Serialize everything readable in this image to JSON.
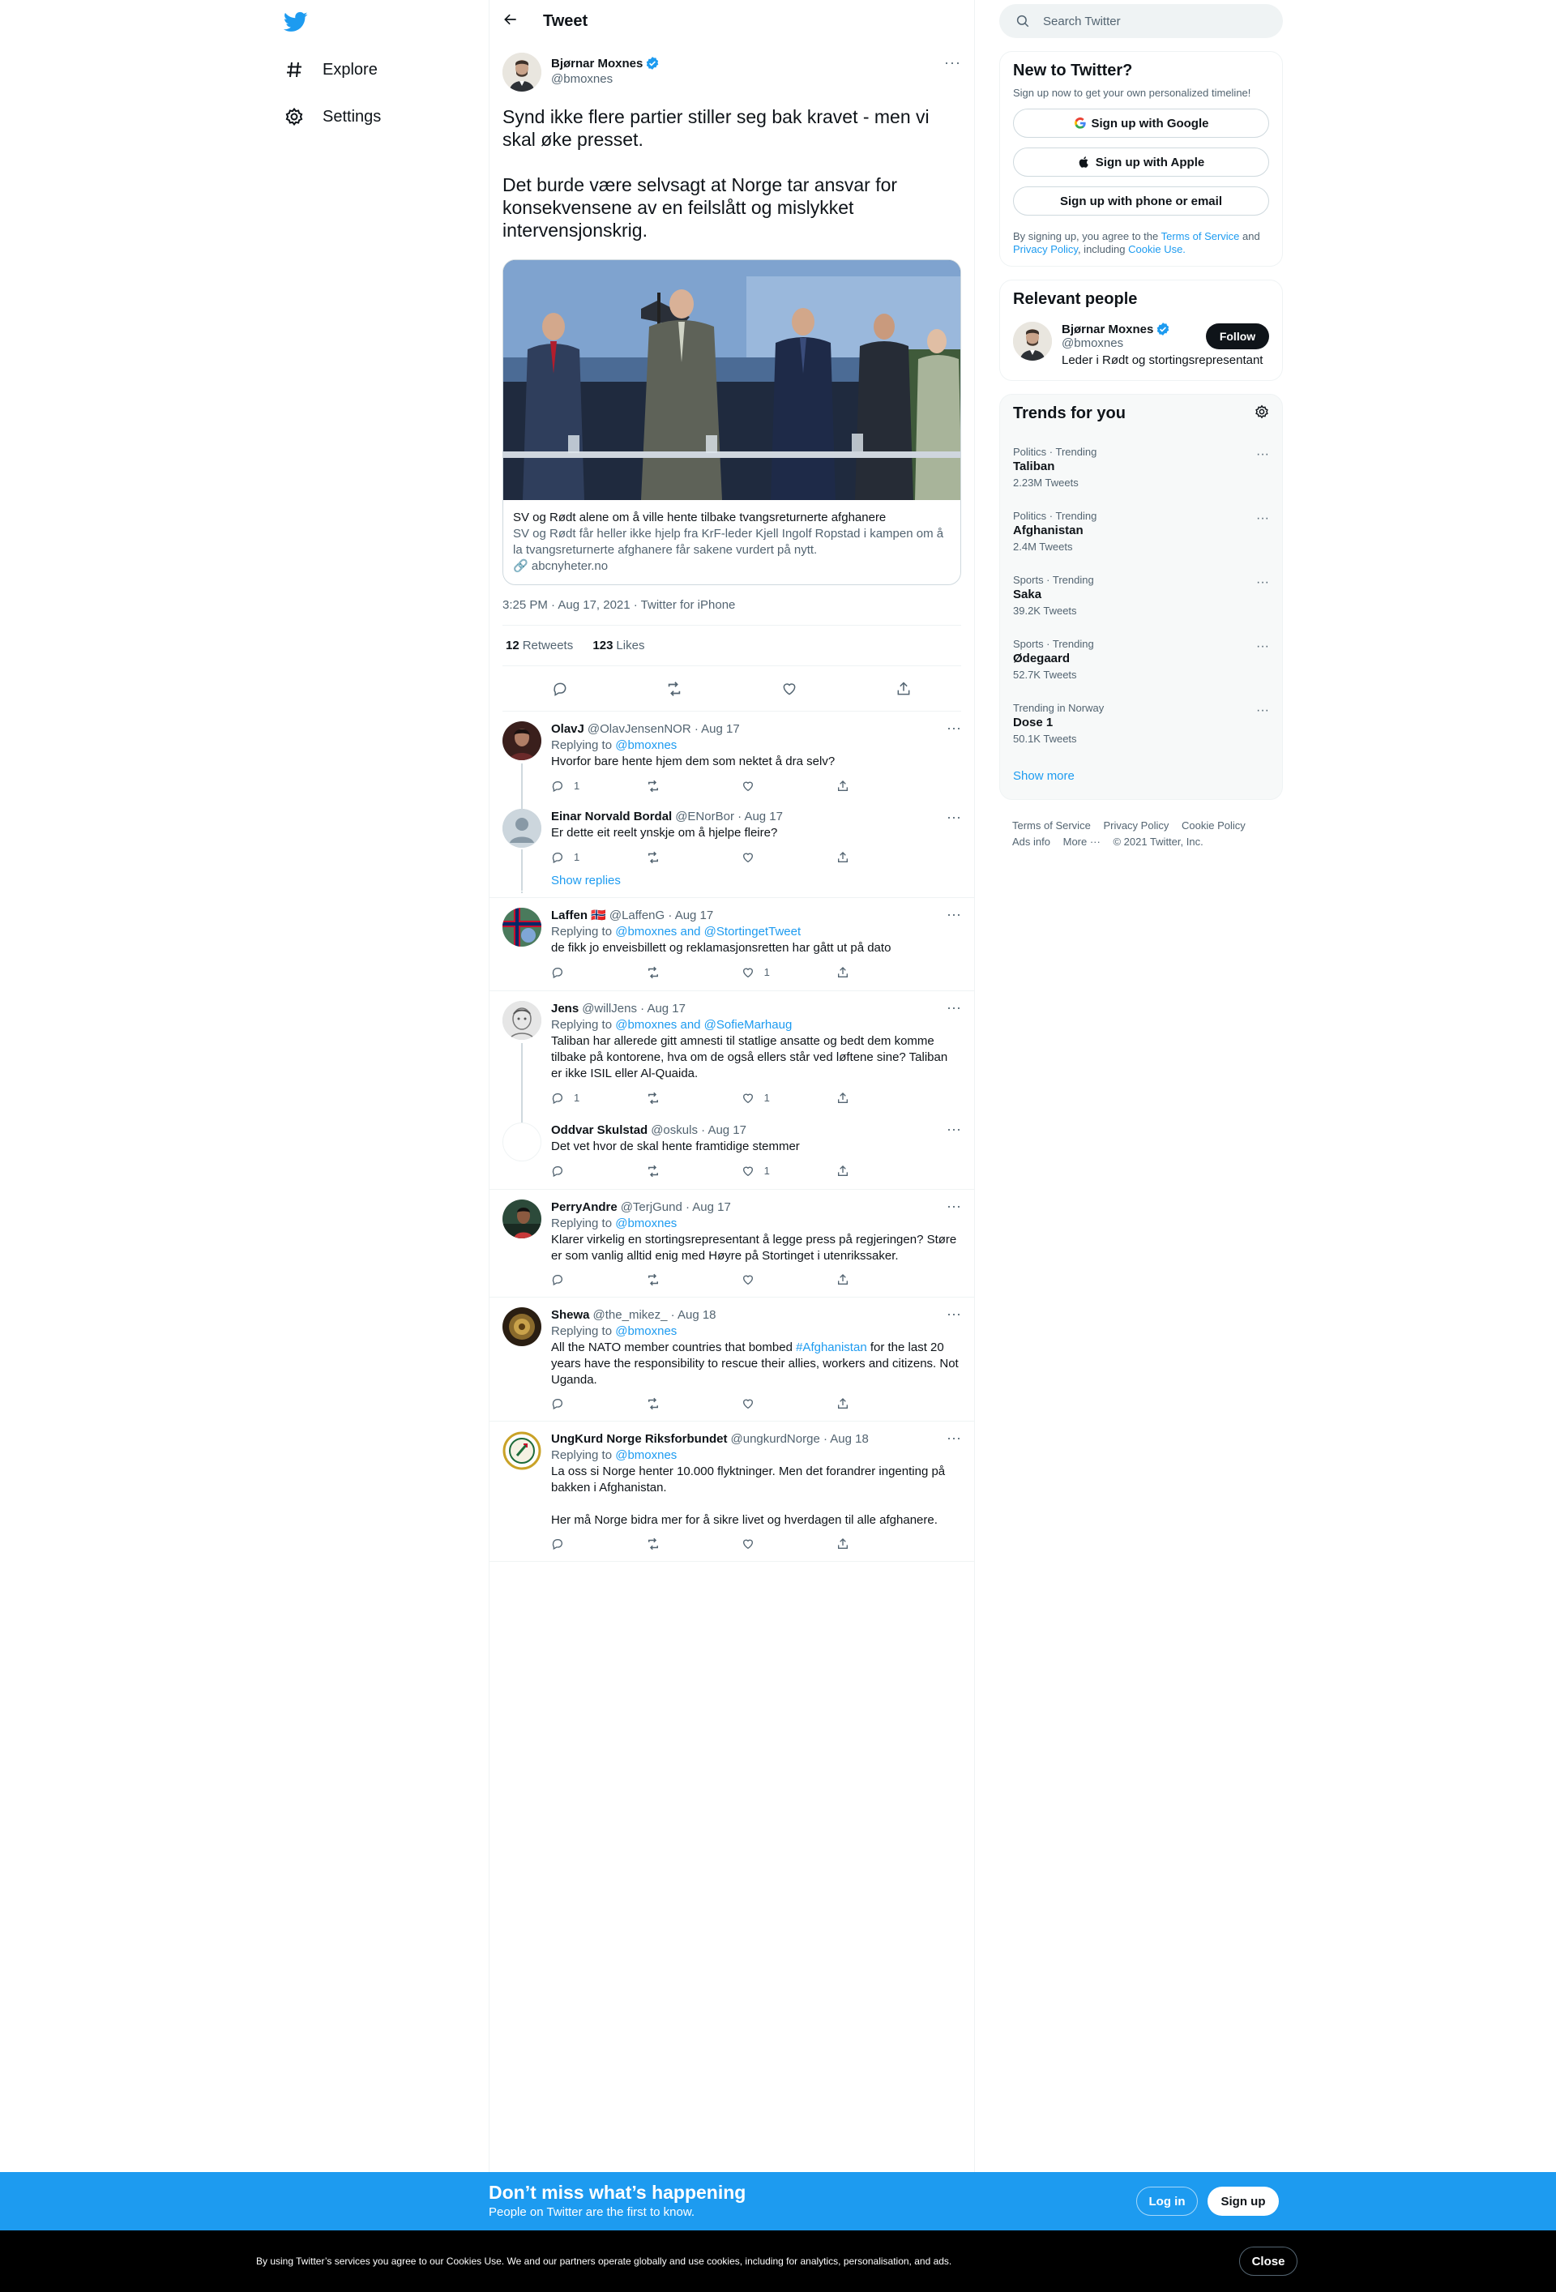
{
  "nav": {
    "explore": "Explore",
    "settings": "Settings"
  },
  "main": {
    "title": "Tweet",
    "tweet": {
      "name": "Bjørnar Moxnes",
      "handle": "@bmoxnes",
      "text": "Synd ikke flere partier stiller seg bak kravet - men vi skal øke presset.\n\nDet burde være selvsagt at Norge tar ansvar for konsekvensene av en feilslått og mislykket intervensjonskrig.",
      "card": {
        "title": "SV og Rødt alene om å ville hente tilbake tvangsreturnerte afghanere",
        "description": "SV og Rødt får heller ikke hjelp fra KrF-leder Kjell Ingolf Ropstad i kampen om å la tvangsreturnerte afghanere får sakene vurdert på nytt.",
        "domain": "abcnyheter.no"
      },
      "timestamp": "3:25 PM · Aug 17, 2021 · Twitter for iPhone",
      "retweets_count": "12",
      "retweets_label": "Retweets",
      "likes_count": "123",
      "likes_label": "Likes"
    },
    "show_replies": "Show replies",
    "replies": [
      {
        "name": "OlavJ",
        "meta": "@OlavJensenNOR · Aug 17",
        "to_prefix": "Replying to ",
        "to": "@bmoxnes",
        "text": "Hvorfor bare hente hjem dem som nektet å dra selv?",
        "replies": "1",
        "retweets": "",
        "likes": ""
      },
      {
        "name": "Einar Norvald Bordal",
        "meta": "@ENorBor · Aug 17",
        "to_prefix": "",
        "to": "",
        "text": "Er dette eit reelt ynskje om å hjelpe fleire?",
        "replies": "1",
        "retweets": "",
        "likes": ""
      },
      {
        "name": "Laffen 🇳🇴",
        "meta": "@LaffenG · Aug 17",
        "to_prefix": "Replying to ",
        "to": "@bmoxnes and @StortingetTweet",
        "text": "de fikk jo enveisbillett og reklamasjonsretten har gått ut på dato",
        "replies": "",
        "retweets": "",
        "likes": "1"
      },
      {
        "name": "Jens",
        "meta": "@willJens · Aug 17",
        "to_prefix": "Replying to ",
        "to": "@bmoxnes and @SofieMarhaug",
        "text": "Taliban har allerede gitt amnesti til statlige ansatte og bedt dem komme tilbake på kontorene, hva om de også ellers står ved løftene sine?  Taliban er ikke ISIL eller Al-Quaida.",
        "replies": "1",
        "retweets": "",
        "likes": "1"
      },
      {
        "name": "Oddvar Skulstad",
        "meta": "@oskuls · Aug 17",
        "to_prefix": "",
        "to": "",
        "text": "Det vet hvor de skal hente framtidige stemmer",
        "replies": "",
        "retweets": "",
        "likes": "1"
      },
      {
        "name": "PerryAndre",
        "meta": "@TerjGund · Aug 17",
        "to_prefix": "Replying to ",
        "to": "@bmoxnes",
        "text": "Klarer virkelig en stortingsrepresentant å legge press på regjeringen? Støre er som vanlig alltid enig med Høyre på Stortinget i utenrikssaker.",
        "replies": "",
        "retweets": "",
        "likes": ""
      },
      {
        "name": "Shewa",
        "meta": "@the_mikez_ · Aug 18",
        "to_prefix": "Replying to ",
        "to": "@bmoxnes",
        "text_before": "All the NATO member countries that bombed ",
        "hashtag": "#Afghanistan",
        "text_after": " for the last 20 years have the responsibility to rescue their allies, workers and citizens. Not Uganda.",
        "replies": "",
        "retweets": "",
        "likes": ""
      },
      {
        "name": "UngKurd Norge Riksforbundet",
        "meta": "@ungkurdNorge · Aug 18",
        "to_prefix": "Replying to ",
        "to": "@bmoxnes",
        "text": "La oss si Norge henter 10.000 flyktninger. Men det forandrer ingenting på bakken i Afghanistan.\n\nHer må Norge bidra mer for å sikre livet og hverdagen til alle afghanere.",
        "replies": "",
        "retweets": "",
        "likes": ""
      }
    ]
  },
  "sidebar": {
    "search_placeholder": "Search Twitter",
    "new": {
      "title": "New to Twitter?",
      "subtitle": "Sign up now to get your own personalized timeline!",
      "google": "Sign up with Google",
      "apple": "Sign up with Apple",
      "phone": "Sign up with phone or email",
      "terms_prefix": "By signing up, you agree to the ",
      "terms_link": "Terms of Service",
      "terms_and": " and ",
      "privacy_link": "Privacy Policy",
      "terms_including": ", including ",
      "cookie_link": "Cookie Use."
    },
    "relevant": {
      "title": "Relevant people",
      "name": "Bjørnar Moxnes",
      "handle": "@bmoxnes",
      "bio": "Leder i Rødt og stortingsrepresentant",
      "follow": "Follow"
    },
    "trends": {
      "title": "Trends for you",
      "items": [
        {
          "context": "Politics · Trending",
          "name": "Taliban",
          "count": "2.23M Tweets"
        },
        {
          "context": "Politics · Trending",
          "name": "Afghanistan",
          "count": "2.4M Tweets"
        },
        {
          "context": "Sports · Trending",
          "name": "Saka",
          "count": "39.2K Tweets"
        },
        {
          "context": "Sports · Trending",
          "name": "Ødegaard",
          "count": "52.7K Tweets"
        },
        {
          "context": "Trending in Norway",
          "name": "Dose 1",
          "count": "50.1K Tweets"
        }
      ],
      "show_more": "Show more"
    },
    "footer": {
      "terms": "Terms of Service",
      "privacy": "Privacy Policy",
      "cookie": "Cookie Policy",
      "ads": "Ads info",
      "more": "More ···",
      "copyright": "© 2021 Twitter, Inc."
    }
  },
  "bottom_bar": {
    "title": "Don’t miss what’s happening",
    "subtitle": "People on Twitter are the first to know.",
    "login": "Log in",
    "signup": "Sign up"
  },
  "cookie_banner": {
    "text": "By using Twitter’s services you agree to our Cookies Use. We and our partners operate globally and use cookies, including for analytics, personalisation, and ads.",
    "close": "Close"
  },
  "colors": {
    "accent": "#1d9bf0",
    "text": "#0f1419",
    "muted": "#536471"
  }
}
